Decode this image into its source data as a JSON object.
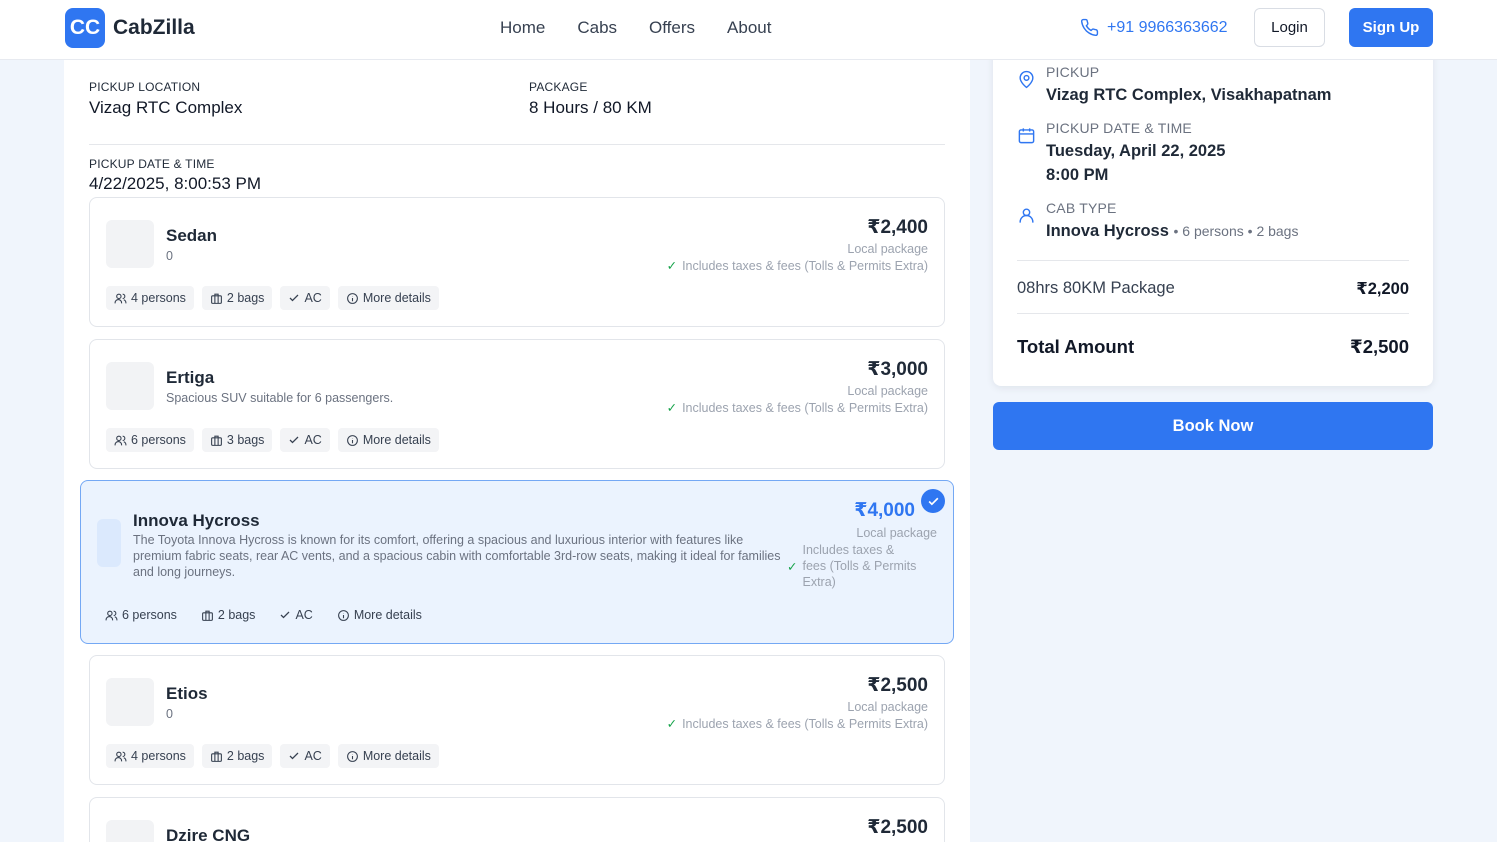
{
  "header": {
    "logo_badge": "CC",
    "brand": "CabZilla",
    "nav": [
      "Home",
      "Cabs",
      "Offers",
      "About"
    ],
    "phone": "+91 9966363662",
    "login": "Login",
    "signup": "Sign Up"
  },
  "trip": {
    "pickup_label": "PICKUP LOCATION",
    "pickup_value": "Vizag RTC Complex",
    "package_label": "PACKAGE",
    "package_value": "8 Hours / 80 KM",
    "date_label": "PICKUP DATE & TIME",
    "date_value": "4/22/2025, 8:00:53 PM"
  },
  "cabs": [
    {
      "name": "Sedan",
      "description": "0",
      "price": "₹2,400",
      "package": "Local package",
      "taxes": "Includes taxes & fees (Tolls & Permits Extra)",
      "persons": "4 persons",
      "bags": "2 bags",
      "ac": "AC",
      "more": "More details",
      "selected": false
    },
    {
      "name": "Ertiga",
      "description": "Spacious SUV suitable for 6 passengers.",
      "price": "₹3,000",
      "package": "Local package",
      "taxes": "Includes taxes & fees (Tolls & Permits Extra)",
      "persons": "6 persons",
      "bags": "3 bags",
      "ac": "AC",
      "more": "More details",
      "selected": false
    },
    {
      "name": "Innova Hycross",
      "description": "The Toyota Innova Hycross is known for its comfort, offering a spacious and luxurious interior with features like premium fabric seats, rear AC vents, and a spacious cabin with comfortable 3rd-row seats, making it ideal for families and long journeys.",
      "price": "₹4,000",
      "package": "Local package",
      "taxes": "Includes taxes & fees (Tolls & Permits Extra)",
      "persons": "6 persons",
      "bags": "2 bags",
      "ac": "AC",
      "more": "More details",
      "selected": true
    },
    {
      "name": "Etios",
      "description": "0",
      "price": "₹2,500",
      "package": "Local package",
      "taxes": "Includes taxes & fees (Tolls & Permits Extra)",
      "persons": "4 persons",
      "bags": "2 bags",
      "ac": "AC",
      "more": "More details",
      "selected": false
    },
    {
      "name": "Dzire CNG",
      "price": "₹2,500",
      "selected": false
    }
  ],
  "summary": {
    "pickup_label": "PICKUP",
    "pickup_value": "Vizag RTC Complex, Visakhapatnam",
    "date_label": "PICKUP DATE & TIME",
    "date_line1": "Tuesday, April 22, 2025",
    "date_line2": "8:00 PM",
    "cab_label": "CAB TYPE",
    "cab_value": "Innova Hycross",
    "cab_meta": "• 6 persons • 2 bags",
    "package_name": "08hrs 80KM Package",
    "package_price": "₹2,200",
    "total_label": "Total Amount",
    "total_value": "₹2,500",
    "book_now": "Book Now"
  },
  "colors": {
    "accent": "#2f76f1",
    "selected_bg": "#ebf3fe",
    "selected_border": "#74a8f4",
    "page_bg": "#f0f5fc"
  }
}
